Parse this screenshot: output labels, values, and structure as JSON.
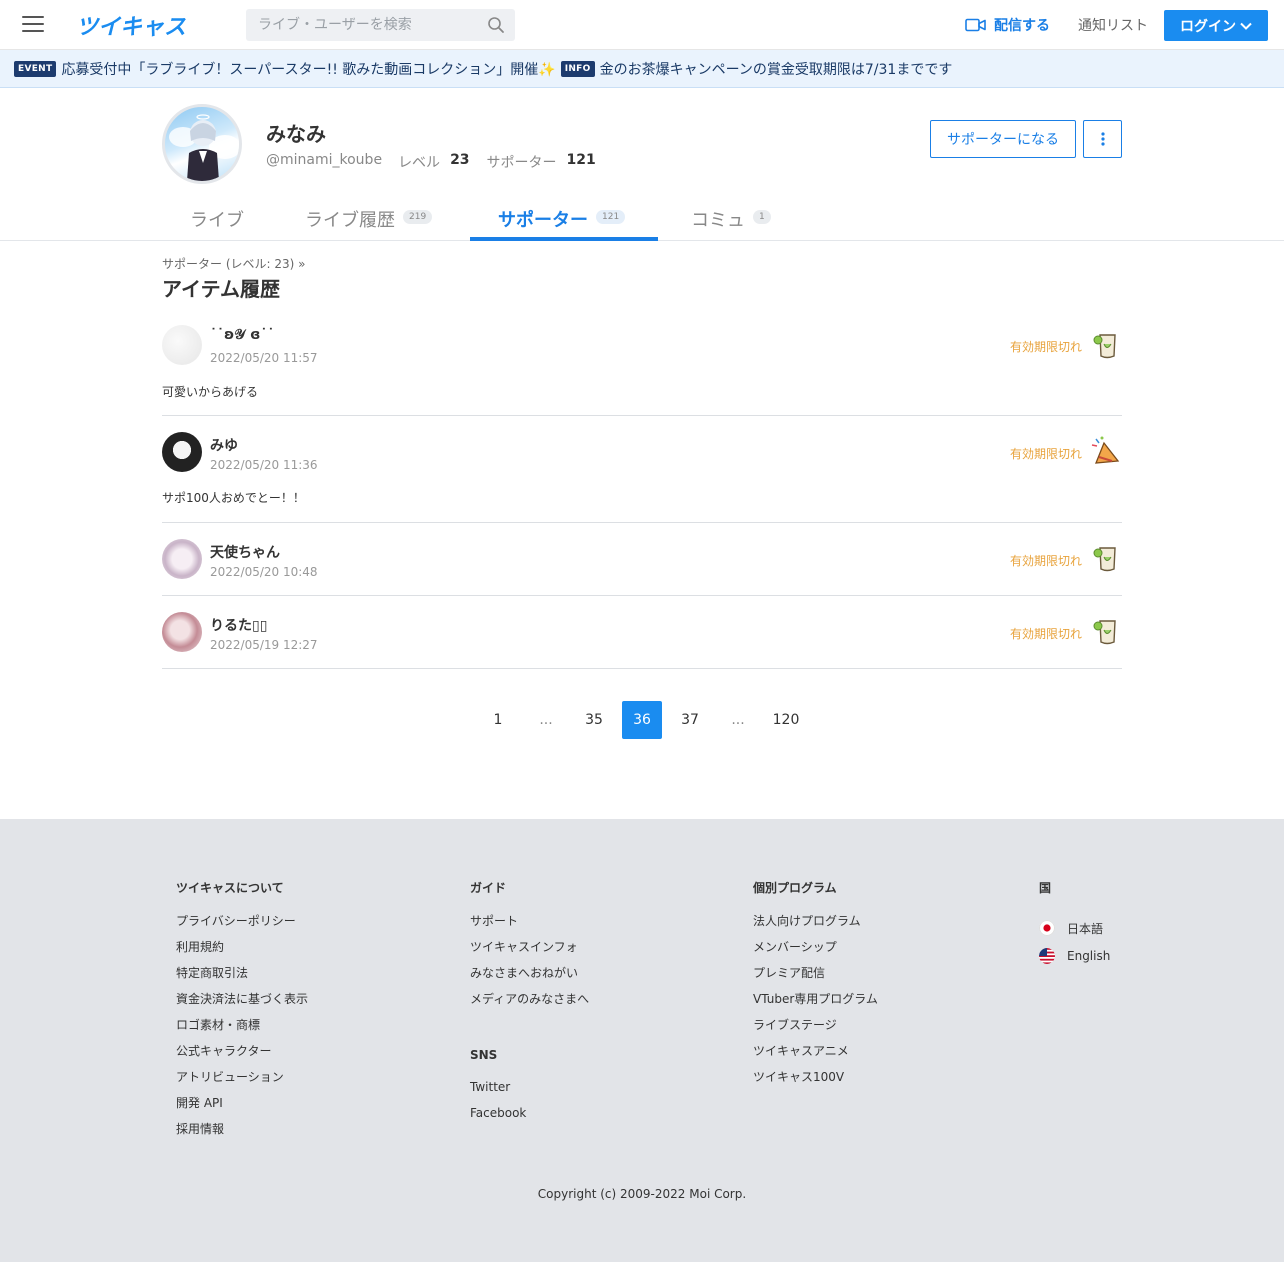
{
  "header": {
    "logo": "ツイキャス",
    "search_placeholder": "ライブ・ユーザーを検索",
    "broadcast": "配信する",
    "notify": "通知リスト",
    "login": "ログイン"
  },
  "news": [
    {
      "badge": "EVENT",
      "text": "応募受付中「ラブライブ！スーパースター!! 歌みた動画コレクション」開催✨"
    },
    {
      "badge": "INFO",
      "text": "金のお茶爆キャンペーンの賞金受取期限は7/31までです"
    }
  ],
  "profile": {
    "name": "みなみ",
    "handle": "@minami_koube",
    "level_label": "レベル",
    "level": "23",
    "supporter_label": "サポーター",
    "supporters": "121",
    "become_supporter": "サポーターになる"
  },
  "tabs": [
    {
      "label": "ライブ",
      "count": ""
    },
    {
      "label": "ライブ履歴",
      "count": "219"
    },
    {
      "label": "サポーター",
      "count": "121"
    },
    {
      "label": "コミュ",
      "count": "1"
    }
  ],
  "content": {
    "breadcrumb": "サポーター (レベル: 23)  »",
    "title": "アイテム履歴"
  },
  "items": [
    {
      "name": "˙˙ʚ𝒴 ɞ˙˙",
      "time": "2022/05/20 11:57",
      "status": "有効期限切れ",
      "message": "可愛いからあげる",
      "gift_icon": "tea-cup-icon"
    },
    {
      "name": "みゆ",
      "time": "2022/05/20 11:36",
      "status": "有効期限切れ",
      "message": "サポ100人おめでとー！！",
      "gift_icon": "party-cracker-icon"
    },
    {
      "name": "天使ちゃん",
      "time": "2022/05/20 10:48",
      "status": "有効期限切れ",
      "message": "",
      "gift_icon": "tea-cup-icon"
    },
    {
      "name": "りるた▯▯",
      "time": "2022/05/19 12:27",
      "status": "有効期限切れ",
      "message": "",
      "gift_icon": "tea-cup-icon"
    }
  ],
  "pagination": [
    "1",
    "...",
    "35",
    "36",
    "37",
    "...",
    "120"
  ],
  "pagination_current": "36",
  "footer": {
    "col1": {
      "title": "ツイキャスについて",
      "links": [
        "プライバシーポリシー",
        "利用規約",
        "特定商取引法",
        "資金決済法に基づく表示",
        "ロゴ素材・商標",
        "公式キャラクター",
        "アトリビューション",
        "開発 API",
        "採用情報"
      ]
    },
    "col2": {
      "title": "ガイド",
      "links": [
        "サポート",
        "ツイキャスインフォ",
        "みなさまへおねがい",
        "メディアのみなさまへ"
      ]
    },
    "col2b": {
      "title": "SNS",
      "links": [
        "Twitter",
        "Facebook"
      ]
    },
    "col3": {
      "title": "個別プログラム",
      "links": [
        "法人向けプログラム",
        "メンバーシップ",
        "プレミア配信",
        "VTuber専用プログラム",
        "ライブステージ",
        "ツイキャスアニメ",
        "ツイキャス100V"
      ]
    },
    "col4": {
      "title": "国",
      "langs": [
        "日本語",
        "English"
      ]
    },
    "copyright": "Copyright (c) 2009-2022 Moi Corp."
  },
  "colors": {
    "accent": "#1a8cf0",
    "expired": "#e8a33c",
    "footer_bg": "#e2e4e8",
    "news_bg": "#eaf3fd"
  }
}
